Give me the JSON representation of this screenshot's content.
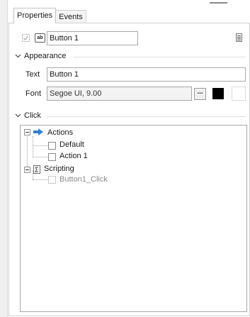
{
  "tabs": [
    {
      "label": "Properties"
    },
    {
      "label": "Events"
    }
  ],
  "object": {
    "name_value": "Button 1",
    "type_icon_text": "ab"
  },
  "appearance": {
    "title": "Appearance",
    "text_label": "Text",
    "text_value": "Button 1",
    "font_label": "Font",
    "font_value": "Segoe UI, 9.00",
    "font_button_label": "...",
    "color_main": "#000000",
    "color_secondary": "#ffffff"
  },
  "click": {
    "title": "Click",
    "tree": {
      "actions_label": "Actions",
      "default_label": "Default",
      "action1_label": "Action 1",
      "scripting_label": "Scripting",
      "handler_label": "Button1_Click"
    }
  },
  "colors": {
    "arrow_blue": "#2f7fd6",
    "disabled_text": "#8a8a8a"
  },
  "icons": [
    "checkbox-disabled-icon",
    "text-button-icon",
    "properties-page-icon",
    "chevron-down-icon",
    "arrow-right-icon",
    "script-icon",
    "tree-expander-minus-icon"
  ]
}
